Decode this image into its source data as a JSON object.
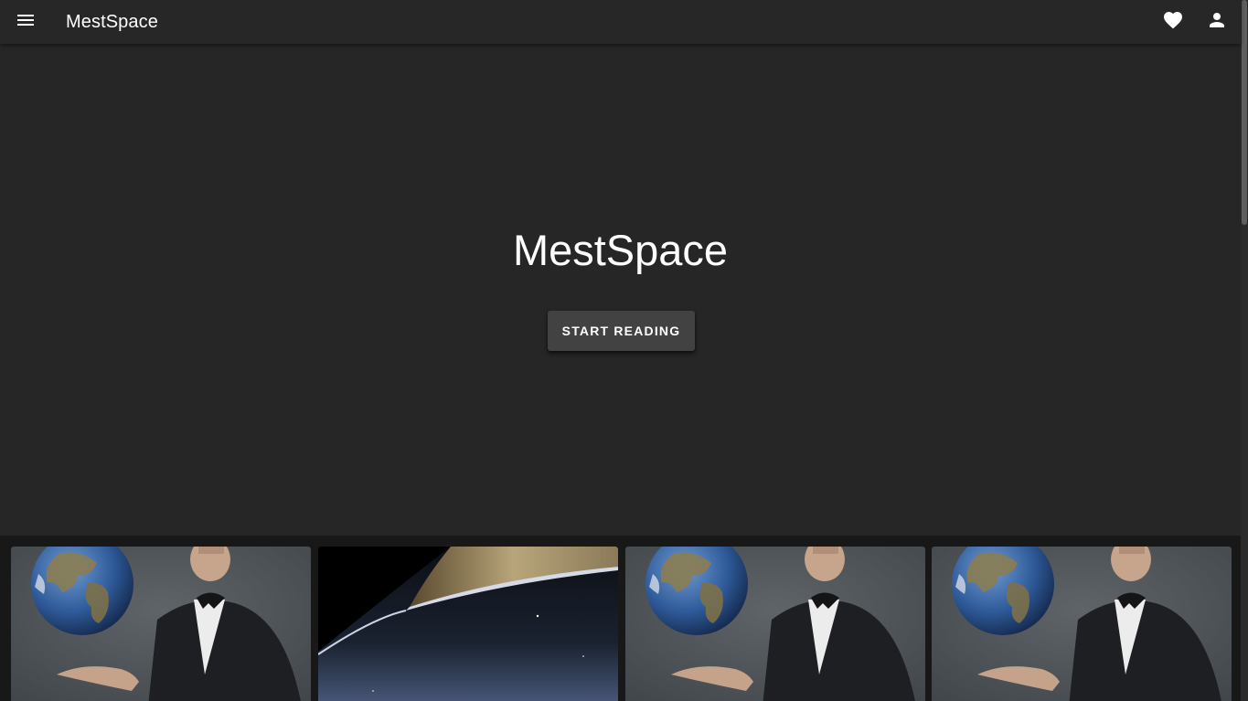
{
  "appbar": {
    "title": "MestSpace",
    "menu_icon": "menu-icon",
    "favorites_icon": "heart-icon",
    "account_icon": "account-icon"
  },
  "hero": {
    "title": "MestSpace",
    "cta_label": "START READING"
  },
  "cards": [
    {
      "image": "globe-person-photo"
    },
    {
      "image": "planet-rings-photo"
    },
    {
      "image": "globe-person-photo"
    },
    {
      "image": "globe-person-photo"
    }
  ],
  "colors": {
    "appbar": "#272727",
    "hero_background": "#262626",
    "button": "#424242",
    "text": "#ffffff"
  }
}
